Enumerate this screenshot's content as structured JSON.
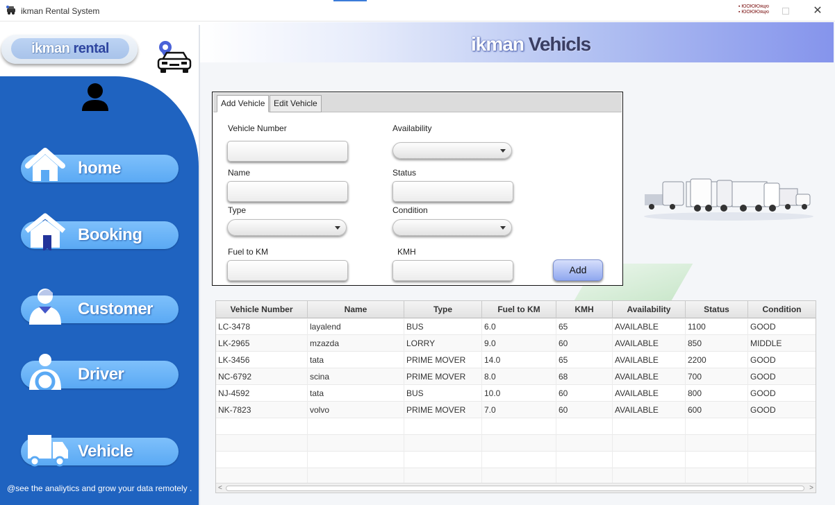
{
  "window": {
    "title": "ikman Rental System",
    "minimize_glyph": "▪ ЮОЮЮяцю\n▪ ЮОЮЮяцю",
    "close_glyph": "✕"
  },
  "brand": {
    "logo_part1": "ikman",
    "logo_part2": "rental",
    "header_part1": "ikman",
    "header_part2": "Vehicls"
  },
  "sidebar": {
    "items": [
      {
        "label": "home",
        "icon": "home-icon"
      },
      {
        "label": "Booking",
        "icon": "booking-icon"
      },
      {
        "label": "Customer",
        "icon": "customer-icon"
      },
      {
        "label": "Driver",
        "icon": "driver-icon"
      },
      {
        "label": "Vehicle",
        "icon": "truck-icon"
      }
    ],
    "footer": "@see the analiytics and grow your data remotely ."
  },
  "tabs": [
    {
      "label": "Add Vehicle",
      "active": true
    },
    {
      "label": "Edit Vehicle",
      "active": false
    }
  ],
  "form": {
    "vehicle_number_label": "Vehicle Number",
    "vehicle_number_value": "",
    "availability_label": "Availability",
    "availability_value": "",
    "name_label": "Name",
    "name_value": "",
    "status_label": "Status",
    "status_value": "",
    "type_label": "Type",
    "type_value": "",
    "condition_label": "Condition",
    "condition_value": "",
    "fuel_label": "Fuel to KM",
    "fuel_value": "",
    "kmh_label": "KMH",
    "kmh_value": "",
    "add_button": "Add"
  },
  "table": {
    "columns": [
      "Vehicle Number",
      "Name",
      "Type",
      "Fuel to KM",
      "KMH",
      "Availability",
      "Status",
      "Condition"
    ],
    "rows": [
      [
        "LC-3478",
        "layalend",
        "BUS",
        "6.0",
        "65",
        "AVAILABLE",
        "1100",
        "GOOD"
      ],
      [
        "LK-2965",
        "mzazda",
        "LORRY",
        "9.0",
        "60",
        "AVAILABLE",
        "850",
        "MIDDLE"
      ],
      [
        "LK-3456",
        "tata",
        "PRIME MOVER",
        "14.0",
        "65",
        "AVAILABLE",
        "2200",
        "GOOD"
      ],
      [
        "NC-6792",
        "scina",
        "PRIME MOVER",
        "8.0",
        "68",
        "AVAILABLE",
        "700",
        "GOOD"
      ],
      [
        "NJ-4592",
        "tata",
        "BUS",
        "10.0",
        "60",
        "AVAILABLE",
        "800",
        "GOOD"
      ],
      [
        "NK-7823",
        "volvo",
        "PRIME MOVER",
        "7.0",
        "60",
        "AVAILABLE",
        "600",
        "GOOD"
      ]
    ],
    "scroll_left": "<",
    "scroll_right": ">"
  },
  "colors": {
    "sidebar": "#1f63c0",
    "nav_button": "#6cb6f8",
    "header_gradient_end": "#8594ec"
  }
}
